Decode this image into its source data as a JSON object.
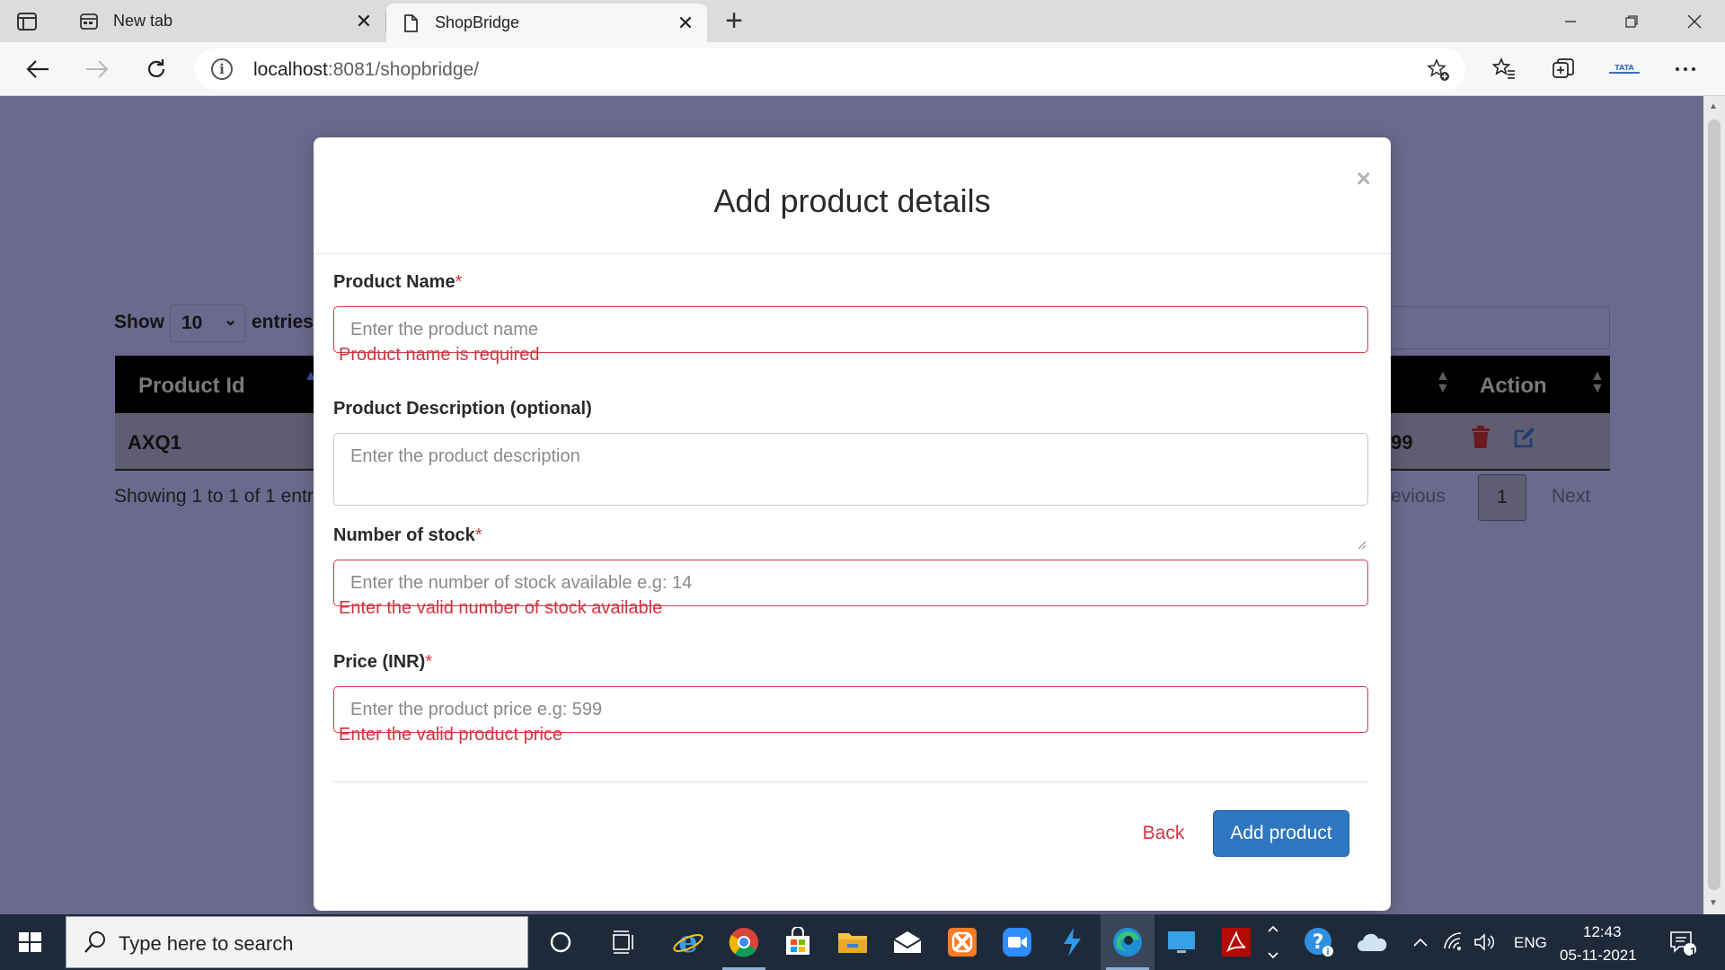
{
  "browser": {
    "tabs": [
      {
        "title": "New tab",
        "icon": "newtab-icon"
      },
      {
        "title": "ShopBridge",
        "icon": "page-icon"
      }
    ],
    "url_host": "localhost",
    "url_rest": ":8081/shopbridge/"
  },
  "background": {
    "show_label": "Show",
    "entries_value": "10",
    "entries_label": "entries",
    "columns": [
      "Product Id",
      "Action"
    ],
    "row": {
      "product_id": "AXQ1",
      "price_fragment": "99"
    },
    "showing_text": "Showing 1 to 1 of 1 entr",
    "pagination": {
      "prev": "revious",
      "page": "1",
      "next": "Next"
    }
  },
  "modal": {
    "title": "Add product details",
    "close": "×",
    "fields": {
      "name": {
        "label": "Product Name",
        "required_mark": "*",
        "placeholder": "Enter the product name",
        "error": "Product name is required"
      },
      "description": {
        "label": "Product Description (optional)",
        "placeholder": "Enter the product description"
      },
      "stock": {
        "label": "Number of stock",
        "required_mark": "*",
        "placeholder": "Enter the number of stock available e.g: 14",
        "error": "Enter the valid number of stock available"
      },
      "price": {
        "label": "Price (INR)",
        "required_mark": "*",
        "placeholder": "Enter the product price e.g: 599",
        "error": "Enter the valid product price"
      }
    },
    "back_label": "Back",
    "submit_label": "Add product"
  },
  "taskbar": {
    "search_placeholder": "Type here to search",
    "language": "ENG",
    "time": "12:43",
    "date": "05-11-2021",
    "notification_count": "1"
  },
  "colors": {
    "error_red": "#d0353f",
    "primary_blue": "#2f77c1",
    "overlay": "#6b6a8e"
  }
}
